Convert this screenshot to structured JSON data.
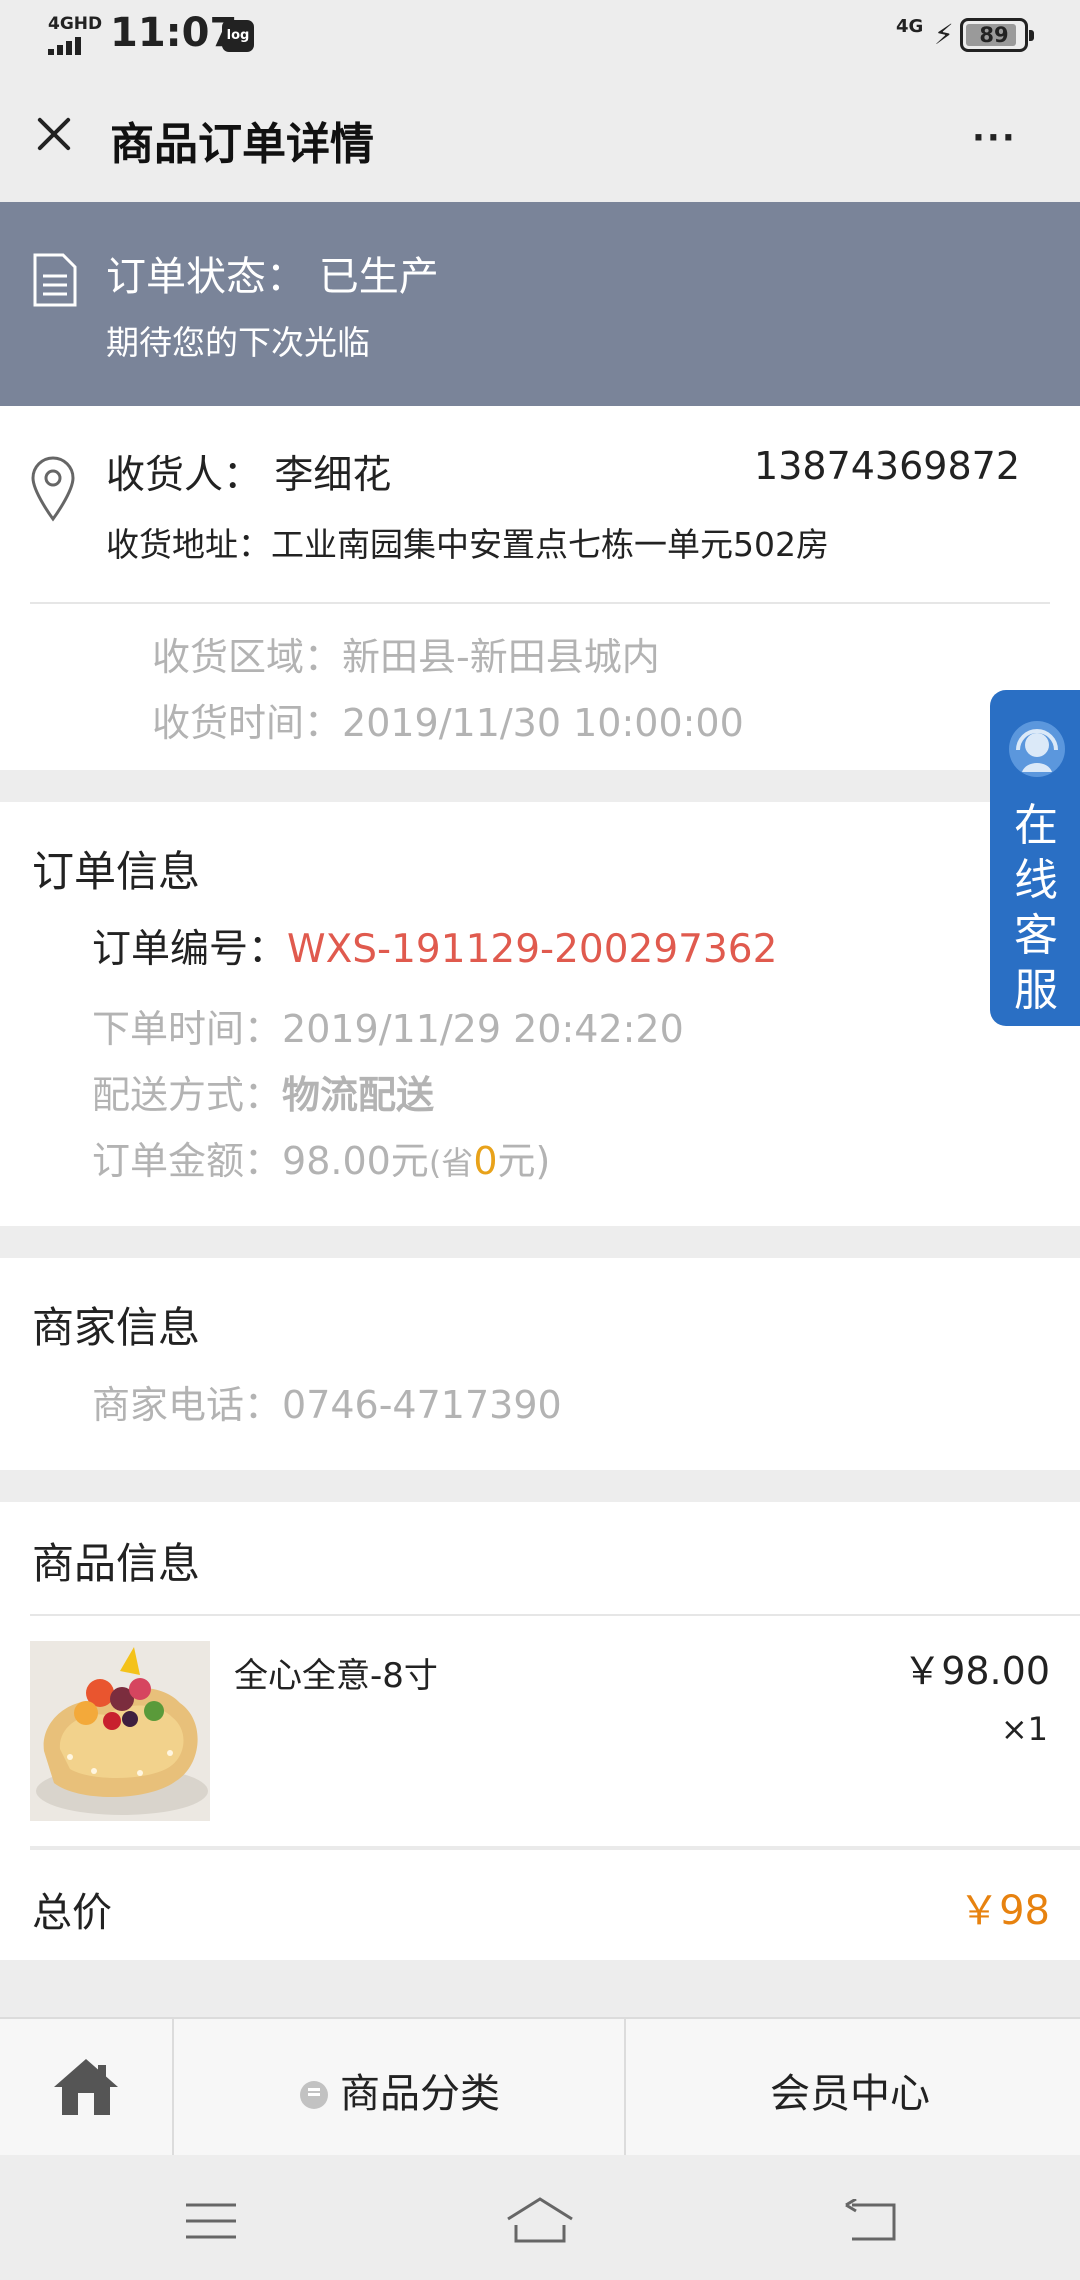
{
  "status_bar": {
    "network": "4GHD",
    "time": "11:07",
    "app_badge": "log",
    "network_right": "4G",
    "battery": "89",
    "battery_fraction": 0.89
  },
  "header": {
    "title": "商品订单详情",
    "more_label": "···"
  },
  "order_status": {
    "label": "订单状态：",
    "value": "已生产",
    "subtitle": "期待您的下次光临"
  },
  "receiver": {
    "name_label": "收货人：",
    "name": "李细花",
    "phone": "13874369872",
    "address_label": "收货地址：",
    "address": "工业南园集中安置点七栋一单元502房",
    "area_label": "收货区域：",
    "area": "新田县-新田县城内",
    "time_label": "收货时间：",
    "time": "2019/11/30 10:00:00"
  },
  "order_info": {
    "title": "订单信息",
    "number_label": "订单编号：",
    "number": "WXS-191129-200297362",
    "placed_label": "下单时间：",
    "placed": "2019/11/29 20:42:20",
    "delivery_label": "配送方式：",
    "delivery": "物流配送",
    "amount_label": "订单金额：",
    "amount": "98.00元",
    "saved_prefix": "(省",
    "saved": "0",
    "saved_suffix": "元)"
  },
  "merchant": {
    "title": "商家信息",
    "phone_label": "商家电话：",
    "phone": "0746-4717390"
  },
  "products": {
    "title": "商品信息",
    "items": [
      {
        "name": "全心全意-8寸",
        "price": "￥98.00",
        "qty": "×1"
      }
    ],
    "total_label": "总价",
    "total": "￥98"
  },
  "online_service": {
    "label": "在线客服"
  },
  "tabbar": {
    "category": "商品分类",
    "member": "会员中心"
  },
  "colors": {
    "banner": "#7a8499",
    "order_number": "#e05a4e",
    "saved": "#e8a21a",
    "total": "#e7820f",
    "service_tab": "#2a6fc4"
  }
}
